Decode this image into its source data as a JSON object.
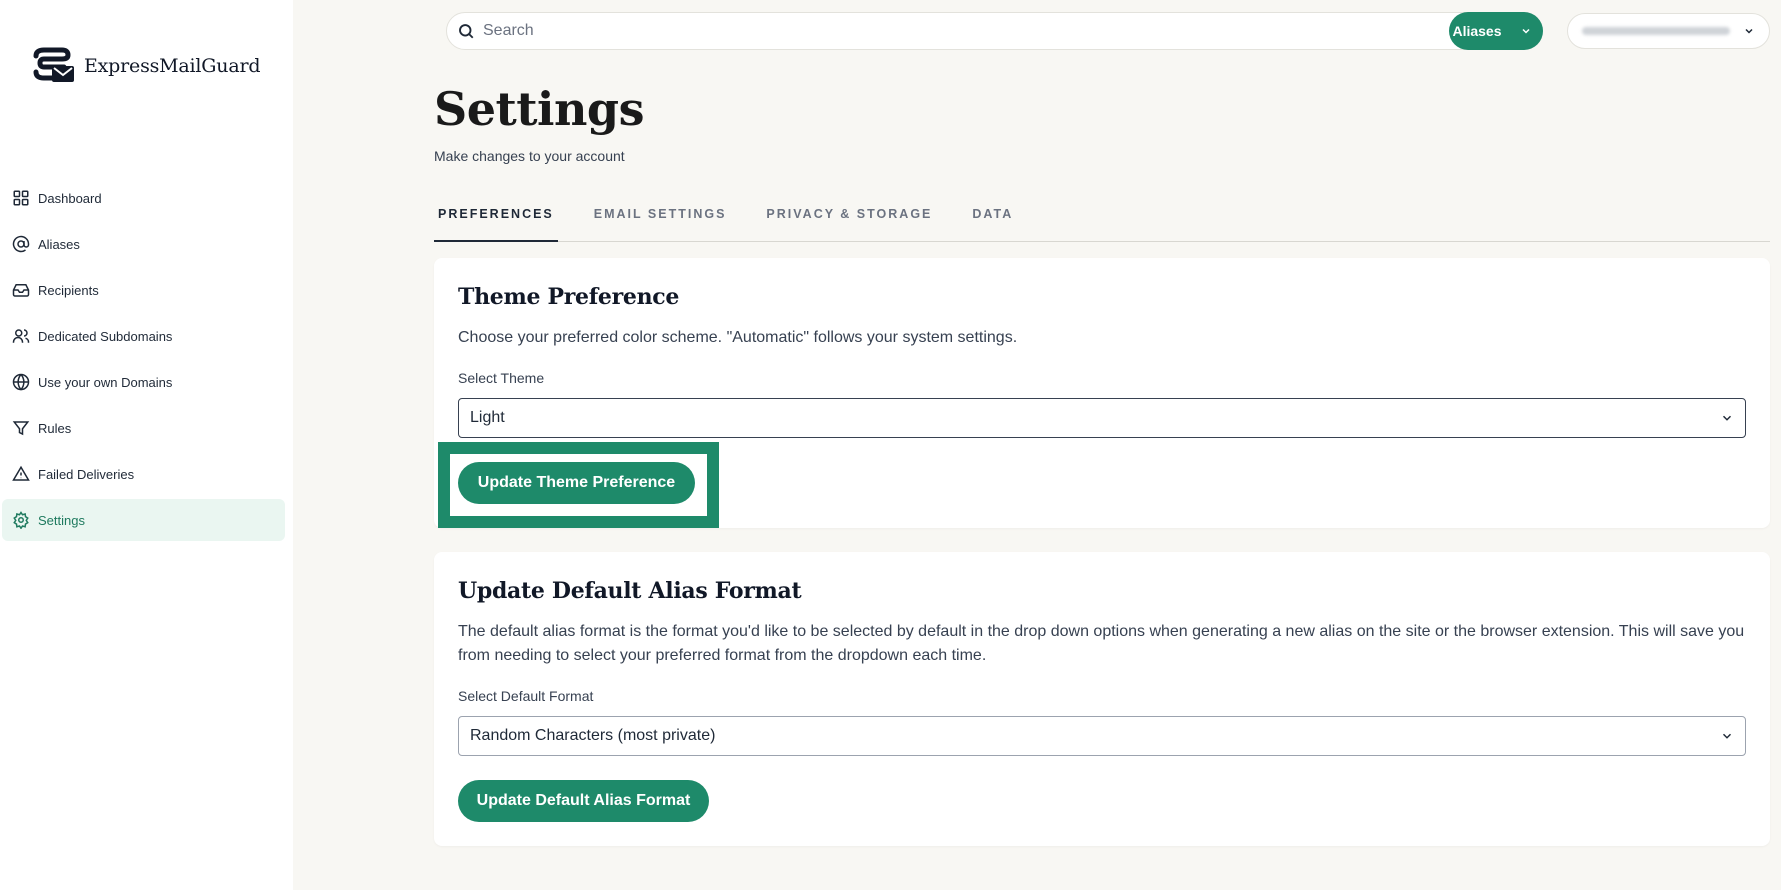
{
  "brand": {
    "name": "ExpressMailGuard"
  },
  "sidebar": {
    "items": [
      {
        "label": "Dashboard",
        "icon": "grid-icon"
      },
      {
        "label": "Aliases",
        "icon": "at-icon"
      },
      {
        "label": "Recipients",
        "icon": "inbox-icon"
      },
      {
        "label": "Dedicated Subdomains",
        "icon": "users-icon"
      },
      {
        "label": "Use your own Domains",
        "icon": "globe-icon"
      },
      {
        "label": "Rules",
        "icon": "filter-icon"
      },
      {
        "label": "Failed Deliveries",
        "icon": "warning-icon"
      },
      {
        "label": "Settings",
        "icon": "gear-icon",
        "active": true
      }
    ]
  },
  "header": {
    "search_placeholder": "Search",
    "aliases_label": "Aliases"
  },
  "page": {
    "title": "Settings",
    "subtitle": "Make changes to your account"
  },
  "tabs": [
    {
      "label": "PREFERENCES",
      "active": true
    },
    {
      "label": "EMAIL SETTINGS"
    },
    {
      "label": "PRIVACY & STORAGE"
    },
    {
      "label": "DATA"
    }
  ],
  "theme": {
    "title": "Theme Preference",
    "description": "Choose your preferred color scheme. \"Automatic\" follows your system settings.",
    "select_label": "Select Theme",
    "selected": "Light",
    "button": "Update Theme Preference"
  },
  "alias_format": {
    "title": "Update Default Alias Format",
    "description": "The default alias format is the format you'd like to be selected by default in the drop down options when generating a new alias on the site or the browser extension. This will save you from needing to select your preferred format from the dropdown each time.",
    "select_label": "Select Default Format",
    "selected": "Random Characters (most private)",
    "button": "Update Default Alias Format"
  },
  "colors": {
    "accent": "#1e8a6a",
    "active_bg": "#eaf6f1",
    "page_bg": "#f8f7f3"
  }
}
